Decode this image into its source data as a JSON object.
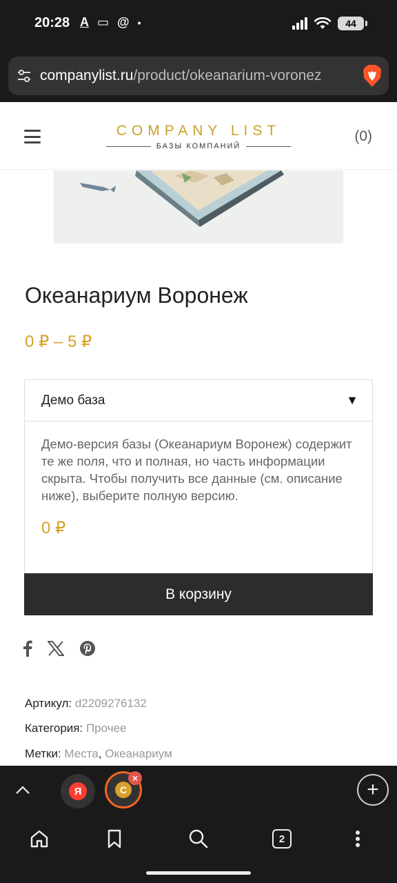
{
  "status_bar": {
    "time": "20:28",
    "left_icons": [
      "A",
      "▭",
      "@",
      "•"
    ],
    "battery": "44"
  },
  "url_bar": {
    "domain": "companylist.ru",
    "path": "/product/okeanarium-voronez"
  },
  "header": {
    "logo_main": "COMPANY LIST",
    "logo_sub": "БАЗЫ КОМПАНИЙ",
    "cart_count": "(0)"
  },
  "product": {
    "title": "Океанариум Воронеж",
    "price_range": "0 ₽ – 5 ₽"
  },
  "variation": {
    "selected": "Демо база",
    "description": "Демо-версия базы (Океанариум Воронеж) содержит те же поля, что и полная, но часть информации скрыта. Чтобы получить все данные (см. описание ниже), выберите полную версию.",
    "price": "0 ₽"
  },
  "add_to_cart_label": "В корзину",
  "share_icons": [
    "facebook-icon",
    "x-icon",
    "pinterest-icon"
  ],
  "meta": {
    "sku_label": "Артикул:",
    "sku_value": "d2209276132",
    "category_label": "Категория:",
    "category_value": "Прочее",
    "tags_label": "Метки:",
    "tag_1": "Места",
    "tag_sep": ",",
    "tag_2": "Океанариум"
  },
  "tabs": {
    "ya_label": "Я",
    "c_label": "C",
    "open_count": "2"
  },
  "colors": {
    "accent_gold": "#d8a02a",
    "button_dark": "#2c2c2c",
    "browser_dark": "#1a1a1a",
    "active_tab_ring": "#f4651f"
  }
}
